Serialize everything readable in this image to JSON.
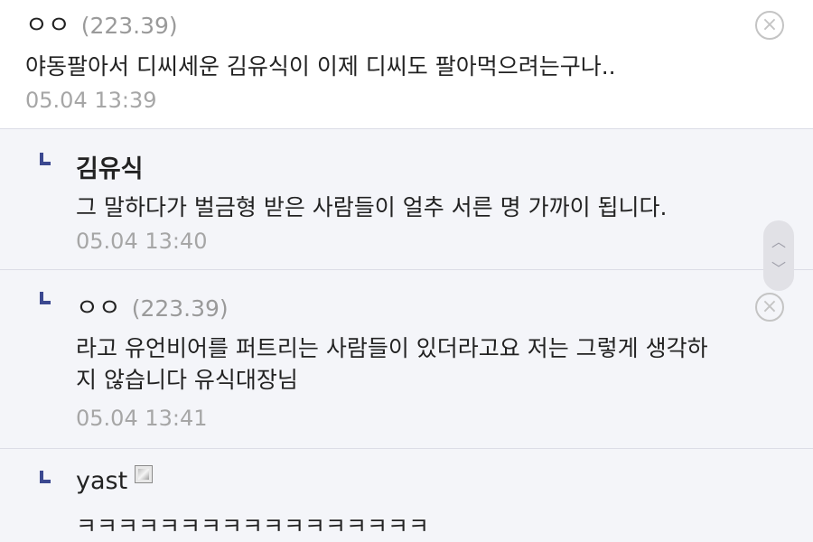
{
  "comments": [
    {
      "nick": "ㅇㅇ",
      "ip": "(223.39)",
      "text": "야동팔아서 디씨세운 김유식이 이제 디씨도 팔아먹으려는구나..",
      "time": "05.04 13:39",
      "icons": {
        "delete": "close-circle-icon"
      }
    },
    {
      "nick": "김유식",
      "text": "그 말하다가 벌금형 받은 사람들이 얼추 서른 명 가까이 됩니다.",
      "time": "05.04 13:40",
      "icons": {
        "reply": "reply-arrow-icon"
      }
    },
    {
      "nick": "ㅇㅇ",
      "ip": "(223.39)",
      "text": "라고 유언비어를 퍼트리는 사람들이 있더라고요 저는 그렇게 생각하\n지 않습니다 유식대장님",
      "time": "05.04 13:41",
      "icons": {
        "reply": "reply-arrow-icon",
        "delete": "close-circle-icon"
      }
    },
    {
      "nick": "yast",
      "text": "ㅋㅋㅋㅋㅋㅋㅋㅋㅋㅋㅋㅋㅋㅋㅋㅋㅋ",
      "icons": {
        "reply": "reply-arrow-icon",
        "badge": "member-badge-icon"
      }
    }
  ],
  "scroll_controls": {
    "up_icon": "chevron-up-icon",
    "down_icon": "chevron-down-icon"
  },
  "colors": {
    "reply_bg": "#f4f5f9",
    "reply_mark": "#3b4890",
    "muted_text": "#a6a6a6",
    "divider": "#dcdde6"
  }
}
